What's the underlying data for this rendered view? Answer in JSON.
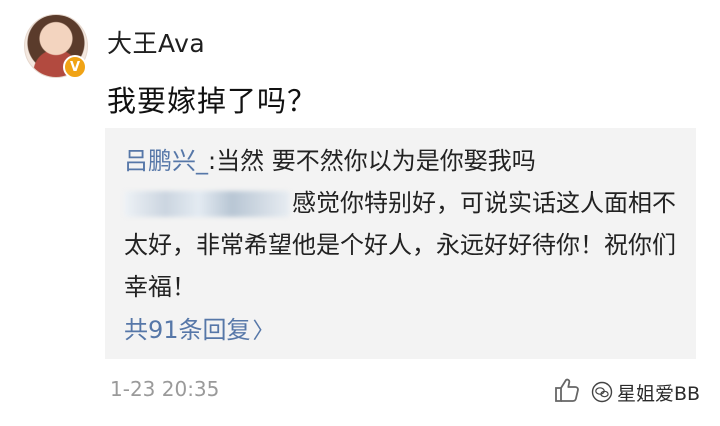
{
  "post": {
    "username": "大王Ava",
    "verified_badge": "V",
    "text": "我要嫁掉了吗？",
    "timestamp": "1-23 20:35"
  },
  "replies": {
    "first": {
      "author": "吕鹏兴_",
      "separator": ":",
      "text": "当然 要不然你以为是你娶我吗"
    },
    "second": {
      "text": "感觉你特别好，可说实话这人面相不太好，非常希望他是个好人，永远好好待你！祝你们幸福！"
    },
    "more_link": "共91条回复",
    "more_chevron": "〉"
  },
  "watermark": {
    "text": "星姐爱BB"
  },
  "colors": {
    "link": "#5677a8",
    "quote_bg": "#f3f3f3",
    "badge": "#f0a315"
  },
  "icons": [
    "avatar",
    "verified-badge-icon",
    "thumbs-up-icon",
    "wechat-watermark-icon"
  ]
}
